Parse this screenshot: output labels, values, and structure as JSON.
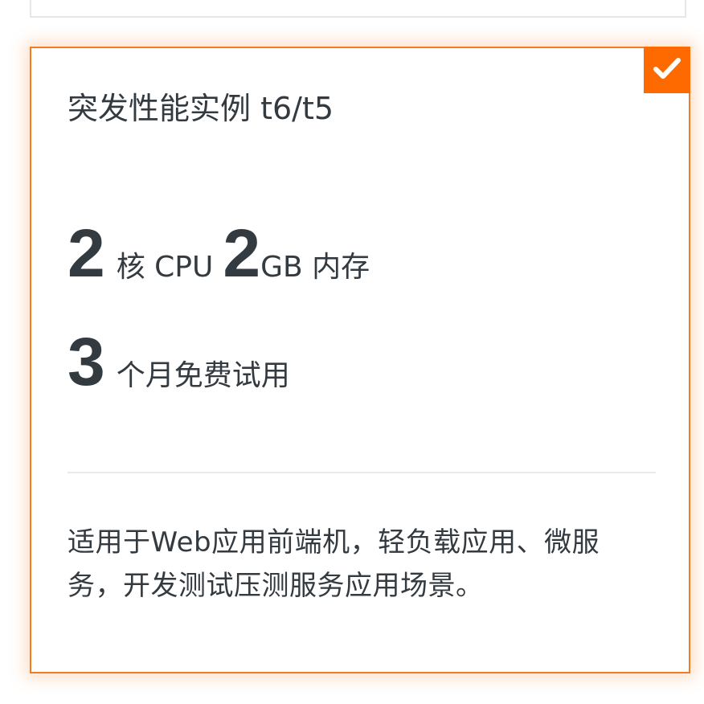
{
  "previous_card": {},
  "card": {
    "selected": true,
    "check_icon": "check-icon",
    "title": "突发性能实例 t6/t5",
    "spec1": {
      "cpu_value": "2",
      "cpu_unit": "核 CPU",
      "mem_value": "2",
      "mem_unit": "GB 内存"
    },
    "spec2": {
      "trial_value": "3",
      "trial_unit": "个月免费试用"
    },
    "description": "适用于Web应用前端机，轻负载应用、微服务，开发测试压测服务应用场景。"
  },
  "colors": {
    "accent": "#ff6a00",
    "border": "#f07c24",
    "text": "#333a40",
    "divider": "#e9eaec"
  }
}
